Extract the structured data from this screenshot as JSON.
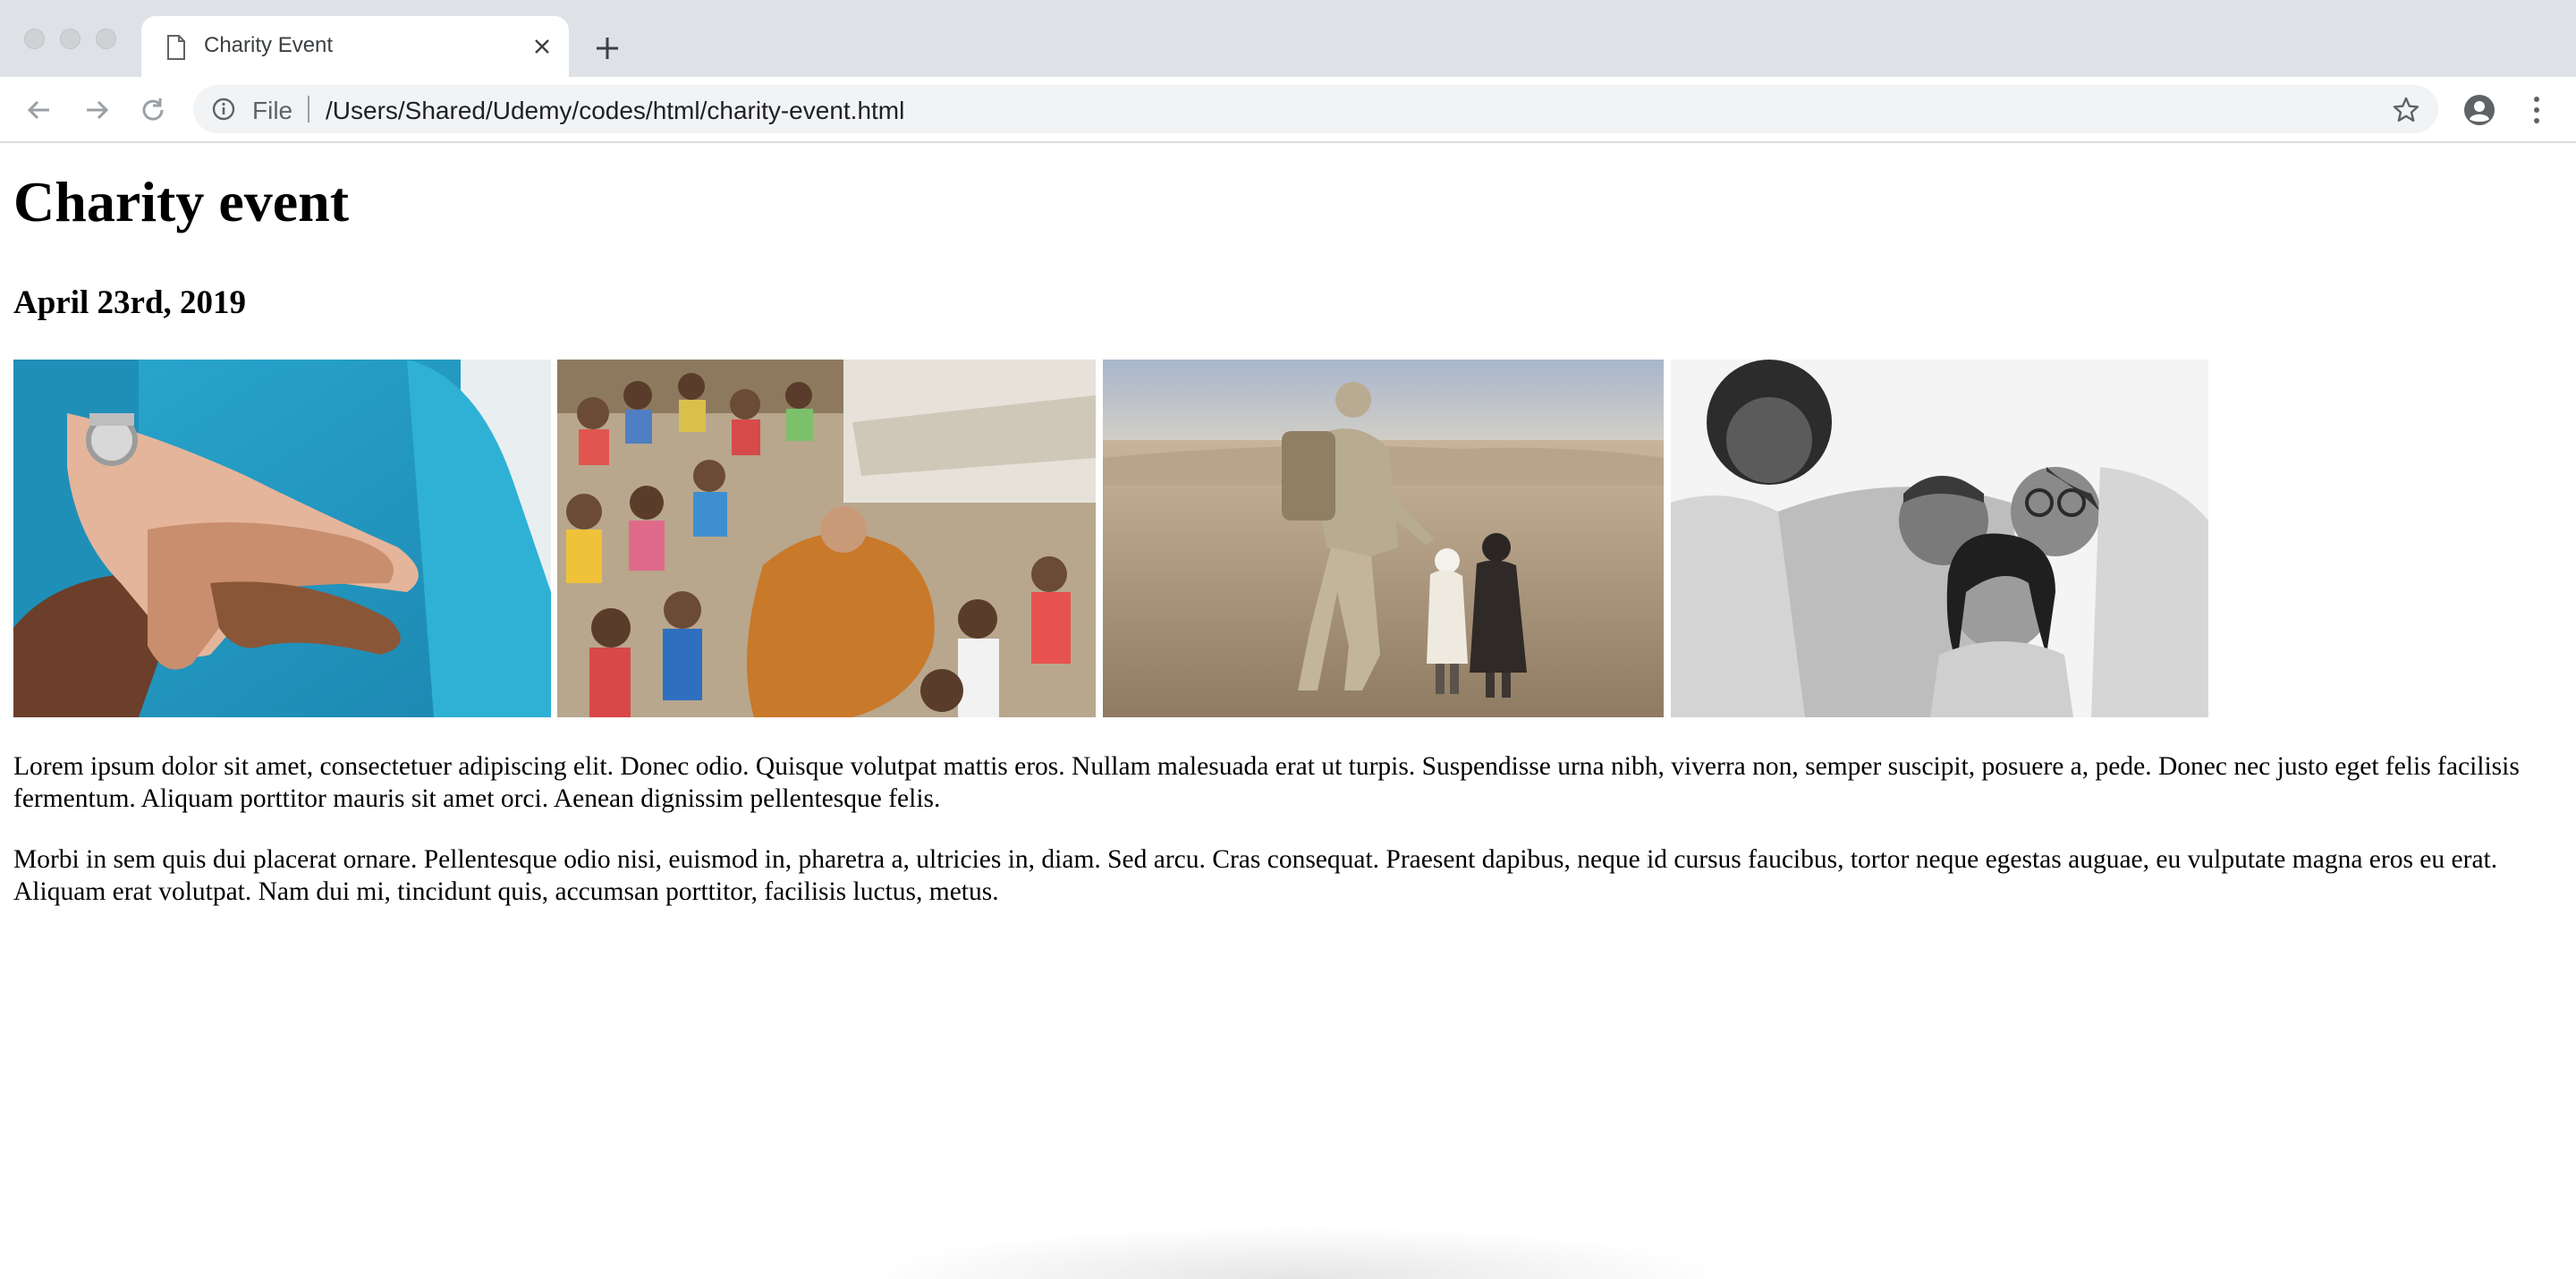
{
  "browser": {
    "tab_title": "Charity Event",
    "address": {
      "scheme_label": "File",
      "url": "/Users/Shared/Udemy/codes/html/charity-event.html"
    },
    "icons": {
      "back": "back-arrow-icon",
      "forward": "forward-arrow-icon",
      "reload": "reload-icon",
      "info": "info-icon",
      "bookmark": "star-icon",
      "account": "account-icon",
      "menu": "more-vert-icon",
      "new_tab": "plus-icon",
      "close_tab": "close-icon"
    }
  },
  "page": {
    "heading": "Charity event",
    "date": "April 23rd, 2019",
    "photos": [
      {
        "subject": "stacked hands of volunteers"
      },
      {
        "subject": "monk handing items to crowd of children"
      },
      {
        "subject": "soldier greeting two small children in desert"
      },
      {
        "subject": "smiling volunteers in black and white"
      }
    ],
    "paragraphs": [
      "Lorem ipsum dolor sit amet, consectetuer adipiscing elit. Donec odio. Quisque volutpat mattis eros. Nullam malesuada erat ut turpis. Suspendisse urna nibh, viverra non, semper suscipit, posuere a, pede. Donec nec justo eget felis facilisis fermentum. Aliquam porttitor mauris sit amet orci. Aenean dignissim pellentesque felis.",
      "Morbi in sem quis dui placerat ornare. Pellentesque odio nisi, euismod in, pharetra a, ultricies in, diam. Sed arcu. Cras consequat. Praesent dapibus, neque id cursus faucibus, tortor neque egestas auguae, eu vulputate magna eros eu erat. Aliquam erat volutpat. Nam dui mi, tincidunt quis, accumsan porttitor, facilisis luctus, metus."
    ]
  },
  "colors": {
    "tabstrip": "#dee1e6",
    "omnibox": "#f1f3f4",
    "icon": "#5f6368"
  }
}
